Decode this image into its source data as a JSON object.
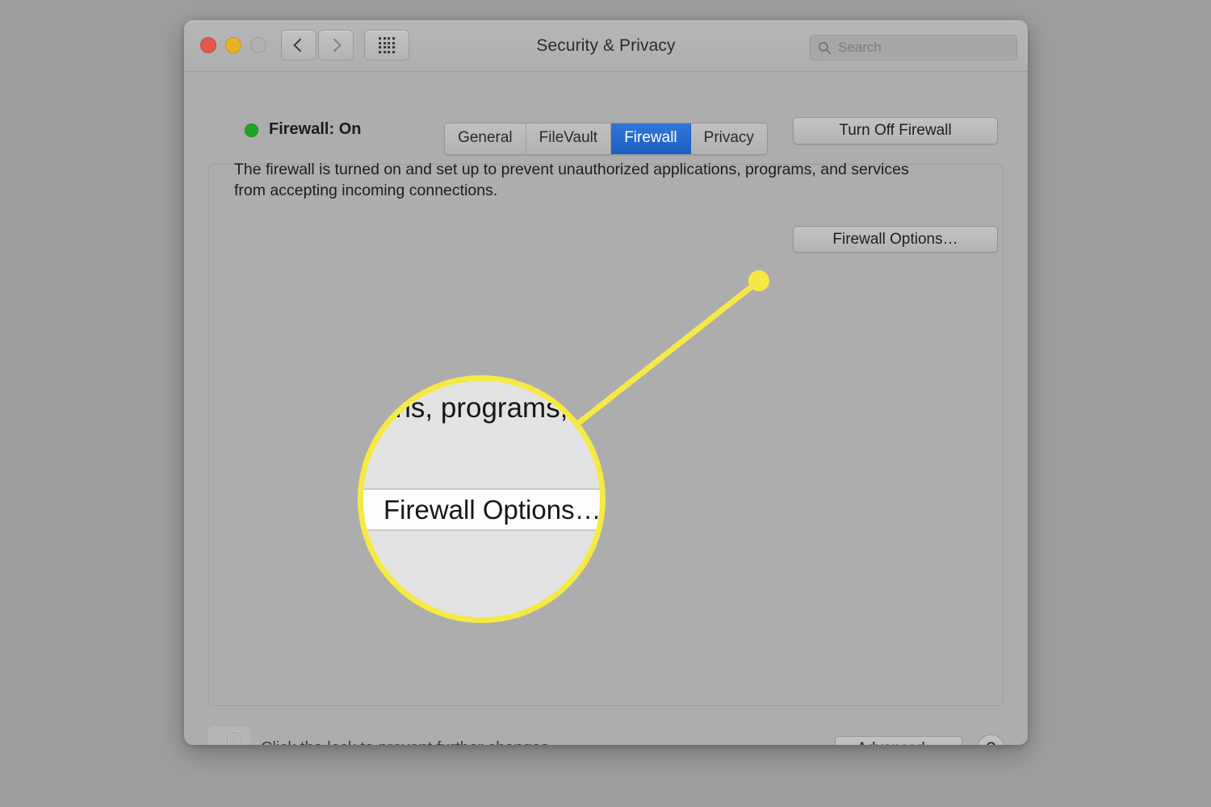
{
  "window": {
    "title": "Security & Privacy",
    "traffic_lights": [
      {
        "name": "close",
        "color": "#e1584f"
      },
      {
        "name": "minimize",
        "color": "#e6b324"
      },
      {
        "name": "zoom",
        "color": "#b0b0b0"
      }
    ],
    "nav": {
      "back_icon": "chevron-left-icon",
      "forward_icon": "chevron-right-icon",
      "grid_icon": "grid-view-icon"
    },
    "search": {
      "icon": "search-icon",
      "placeholder": "Search",
      "value": ""
    }
  },
  "tabs": [
    {
      "label": "General",
      "active": false
    },
    {
      "label": "FileVault",
      "active": false
    },
    {
      "label": "Firewall",
      "active": true
    },
    {
      "label": "Privacy",
      "active": false
    }
  ],
  "panel": {
    "status": {
      "dot_color": "#1fa524",
      "label": "Firewall: On"
    },
    "turn_off_button": "Turn Off Firewall",
    "description": "The firewall is turned on and set up to prevent unauthorized applications, programs, and services from accepting incoming connections.",
    "firewall_options_button": "Firewall Options…"
  },
  "bottom_bar": {
    "lock_icon": "unlocked-padlock-icon",
    "lock_caption": "Click the lock to prevent further changes.",
    "advanced_button": "Advanced…",
    "help_button": "?"
  },
  "annotation": {
    "accent_color": "#f7e944",
    "magnifier": {
      "top_text": "ons, programs,",
      "highlighted_text": "Firewall Options…"
    }
  }
}
